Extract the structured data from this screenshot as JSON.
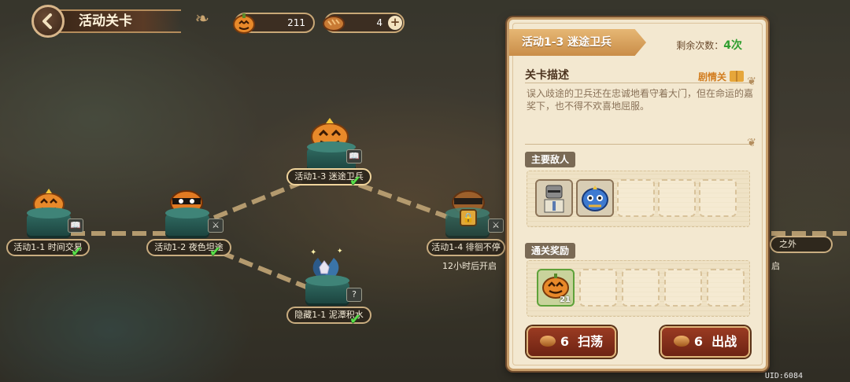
{
  "header": {
    "title": "活动关卡",
    "resource_pumpkin": "211",
    "resource_bread": "4"
  },
  "nodes": {
    "n1": {
      "label": "活动1-1 时间交易"
    },
    "n2": {
      "label": "活动1-2 夜色坦途"
    },
    "n3": {
      "label": "活动1-3 迷途卫兵"
    },
    "n4": {
      "label": "活动1-4 徘徊不停",
      "sub": "12小时后开启"
    },
    "hidden": {
      "label": "隐藏1-1 泥潭积水"
    },
    "edge_right": {
      "label": "之外",
      "sub": "启"
    }
  },
  "panel": {
    "tab_title": "活动1-3  迷途卫兵",
    "remaining_label": "剩余次数：",
    "remaining_value": "4次",
    "desc_heading": "关卡描述",
    "story_link": "剧情关",
    "description": "误入歧途的卫兵还在忠诚地看守着大门，但在命运的嘉奖下，也不得不欢喜地屈服。",
    "enemies_heading": "主要敌人",
    "rewards_heading": "通关奖励",
    "reward_count": "21",
    "sweep_cost": "6",
    "sweep_label": "扫荡",
    "battle_cost": "6",
    "battle_label": "出战"
  },
  "footer": {
    "uid": "UID:6084"
  },
  "colors": {
    "accent": "#c98d48",
    "button": "#7a2a17",
    "remaining": "#2f9e2f"
  }
}
